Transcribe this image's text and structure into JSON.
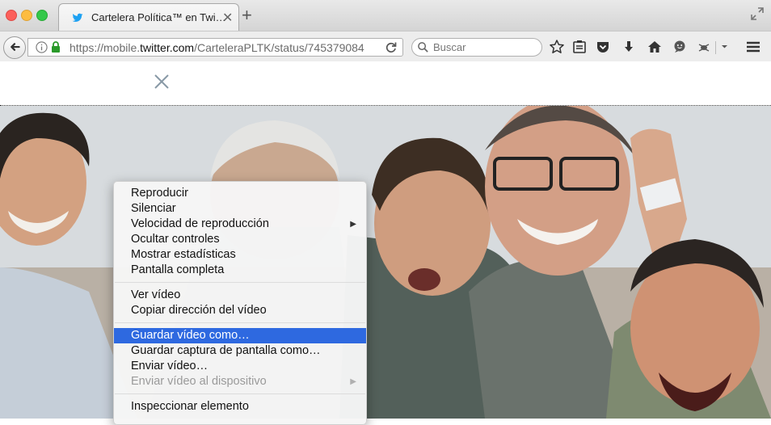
{
  "browser": {
    "tab": {
      "title": "Cartelera Política™ en Twi…",
      "close": "✕",
      "new_tab": "+"
    },
    "address_bar": {
      "url_prefix": "https://mobile.",
      "url_domain": "twitter.com",
      "url_suffix": "/CarteleraPLTK/status/745379084"
    },
    "search_bar": {
      "placeholder": "Buscar"
    }
  },
  "page": {
    "close_label": "✕"
  },
  "context_menu": {
    "group1": [
      "Reproducir",
      "Silenciar",
      "Velocidad de reproducción",
      "Ocultar controles",
      "Mostrar estadísticas",
      "Pantalla completa"
    ],
    "group2": [
      "Ver vídeo",
      "Copiar dirección del vídeo"
    ],
    "group3": [
      "Guardar vídeo como…",
      "Guardar captura de pantalla como…",
      "Enviar vídeo…",
      "Enviar vídeo al dispositivo"
    ],
    "group4": [
      "Inspeccionar elemento"
    ],
    "submenu_arrow": "▶"
  },
  "colors": {
    "highlight": "#2e69e0",
    "twitter_blue": "#1da1f2"
  }
}
